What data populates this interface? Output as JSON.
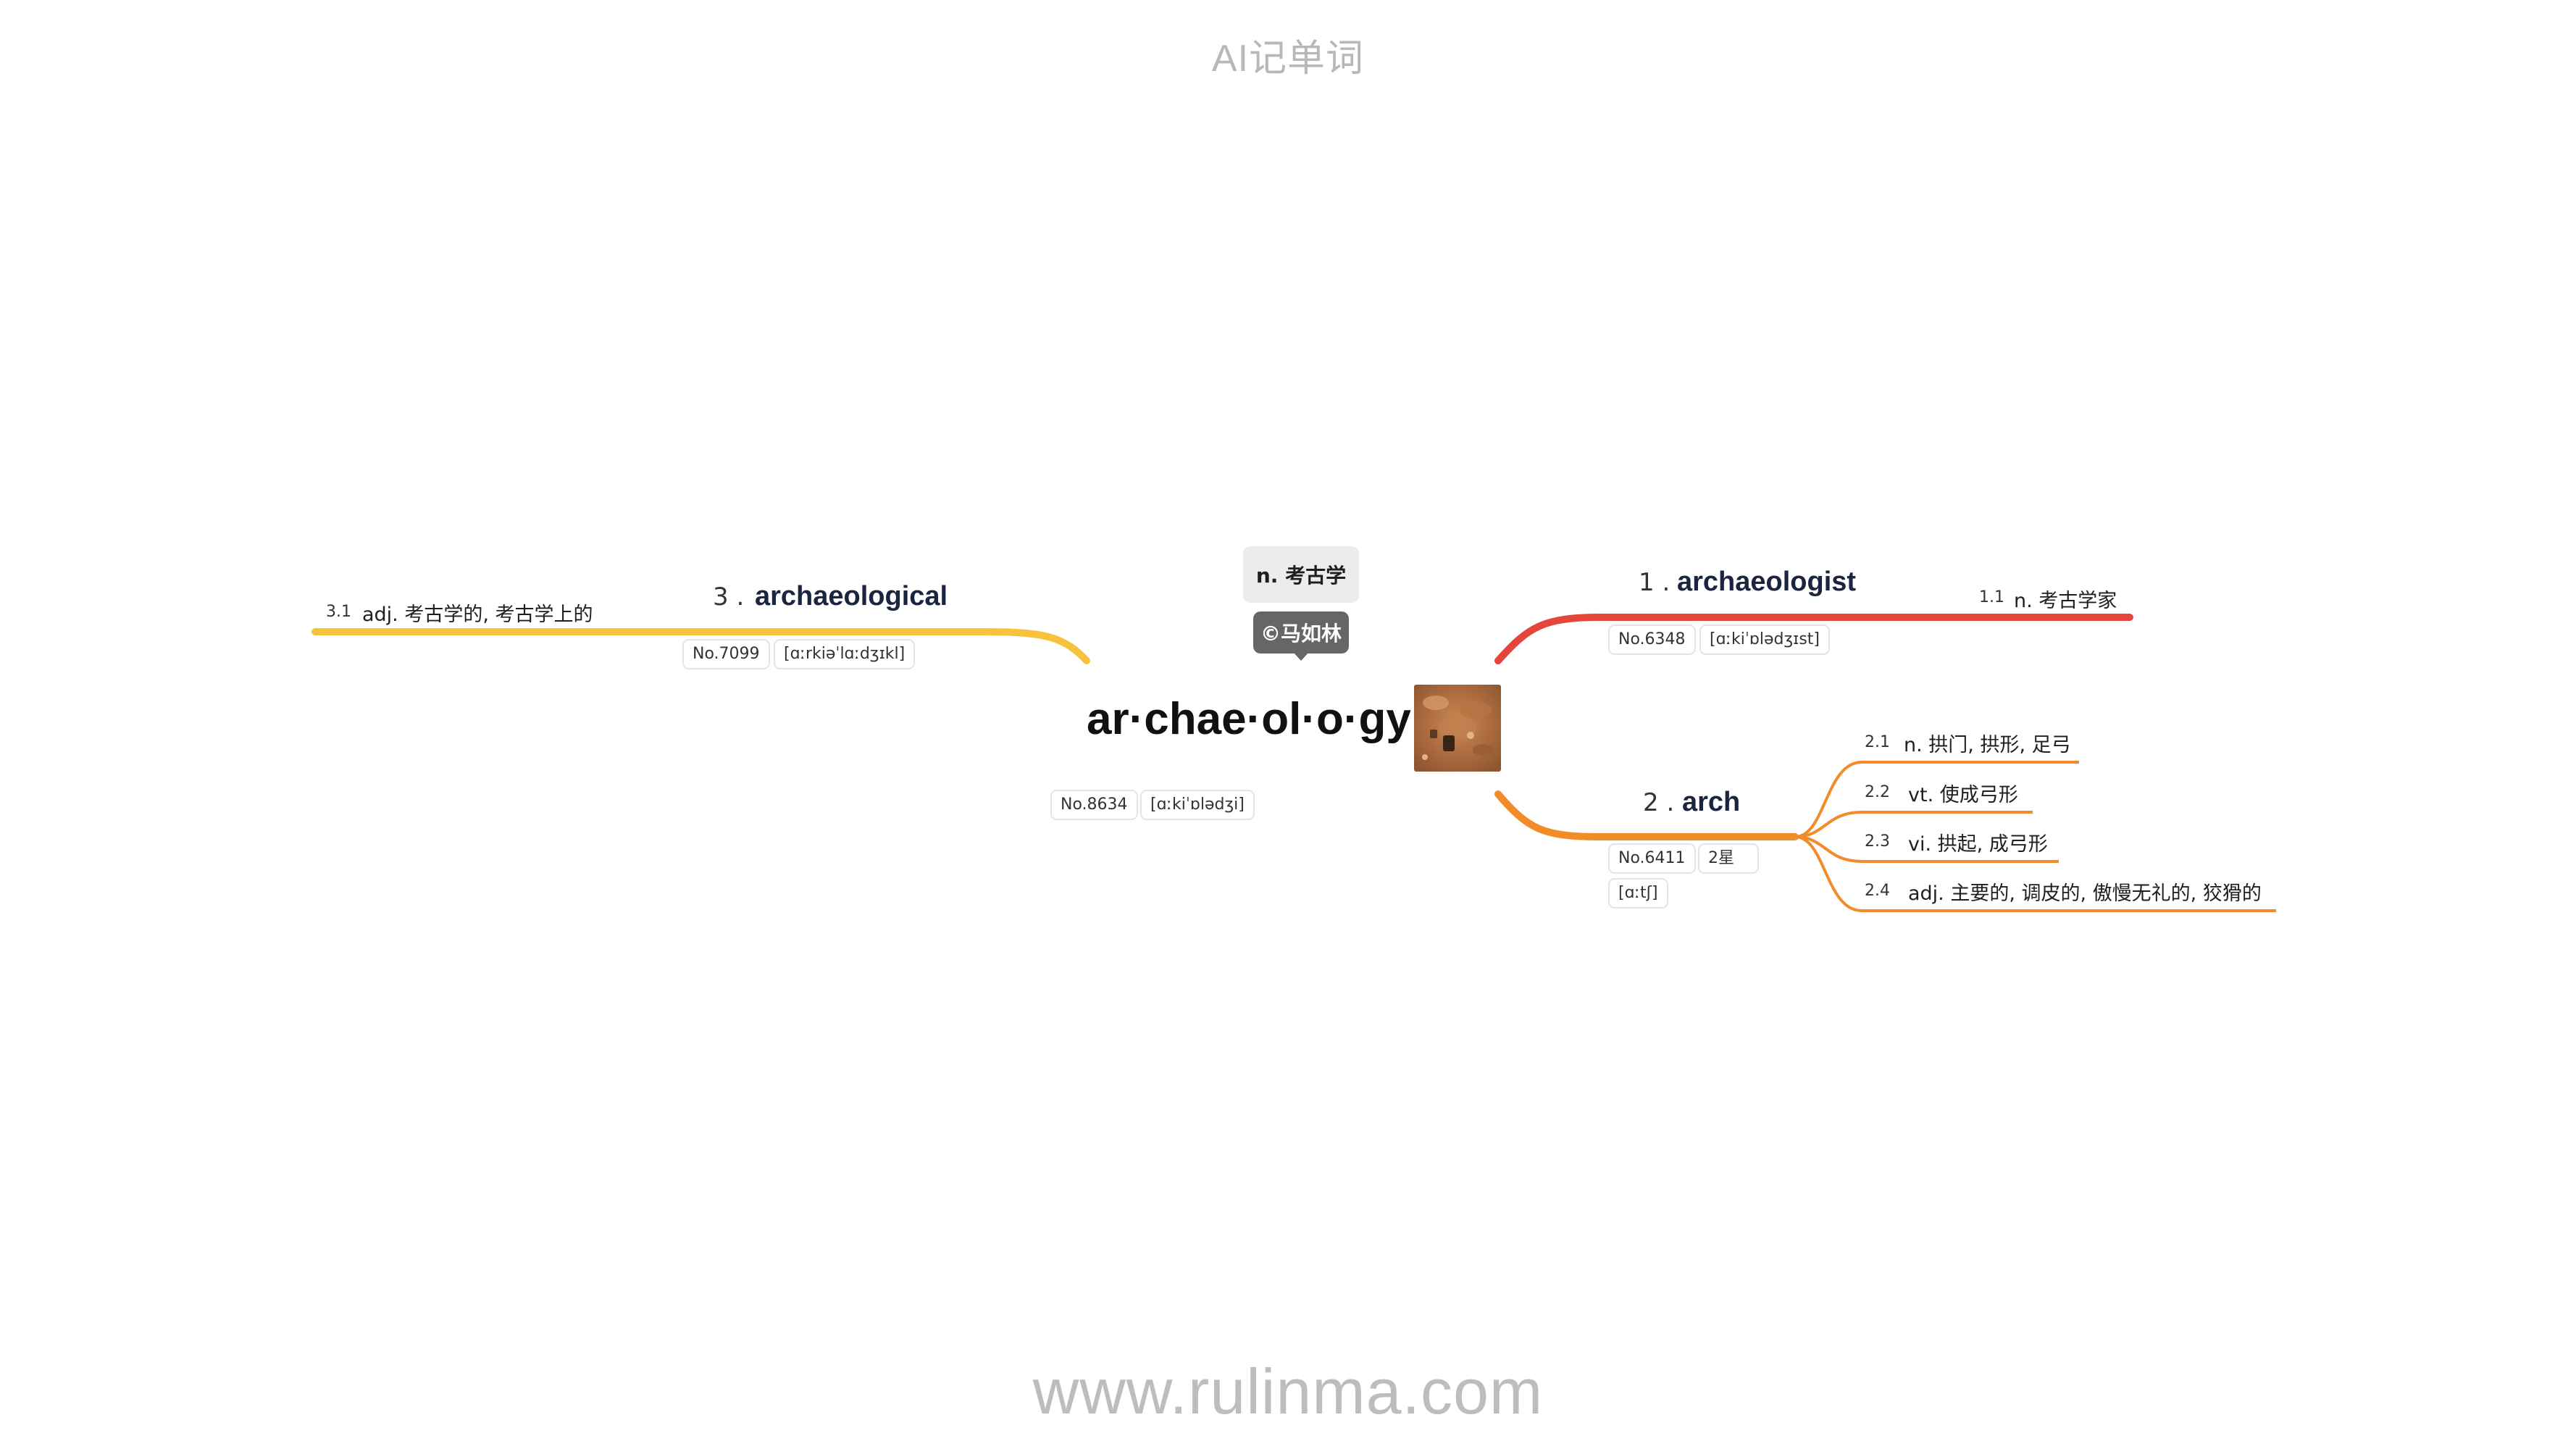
{
  "header": {
    "title": "AI记单词"
  },
  "footer": {
    "url": "www.rulinma.com"
  },
  "central": {
    "word": "ar·chae·ol·o·gy",
    "pos_chip": "n. 考古学",
    "author_chip": "©马如林",
    "number": "No.8634",
    "phonetic": "[ɑːkiˈɒlədʒi]"
  },
  "branches": [
    {
      "index": "1 .",
      "word": "archaeologist",
      "color": "#e5463b",
      "number": "No.6348",
      "phonetic": "[ɑːkiˈɒlədʒɪst]",
      "senses": [
        {
          "num": "1.1",
          "text": "n. 考古学家"
        }
      ]
    },
    {
      "index": "2 .",
      "word": "arch",
      "color": "#f28c28",
      "number": "No.6411",
      "stars": "2星",
      "phonetic": "[ɑːtʃ]",
      "senses": [
        {
          "num": "2.1",
          "text": "n. 拱门, 拱形, 足弓"
        },
        {
          "num": "2.2",
          "text": "vt. 使成弓形"
        },
        {
          "num": "2.3",
          "text": "vi. 拱起, 成弓形"
        },
        {
          "num": "2.4",
          "text": "adj. 主要的, 调皮的, 傲慢无礼的, 狡猾的"
        }
      ]
    },
    {
      "index": "3 .",
      "word": "archaeological",
      "color": "#f5c43c",
      "number": "No.7099",
      "phonetic": "[ɑːrkiəˈlɑːdʒɪkl]",
      "senses": [
        {
          "num": "3.1",
          "text": "adj. 考古学的, 考古学上的"
        }
      ]
    }
  ]
}
